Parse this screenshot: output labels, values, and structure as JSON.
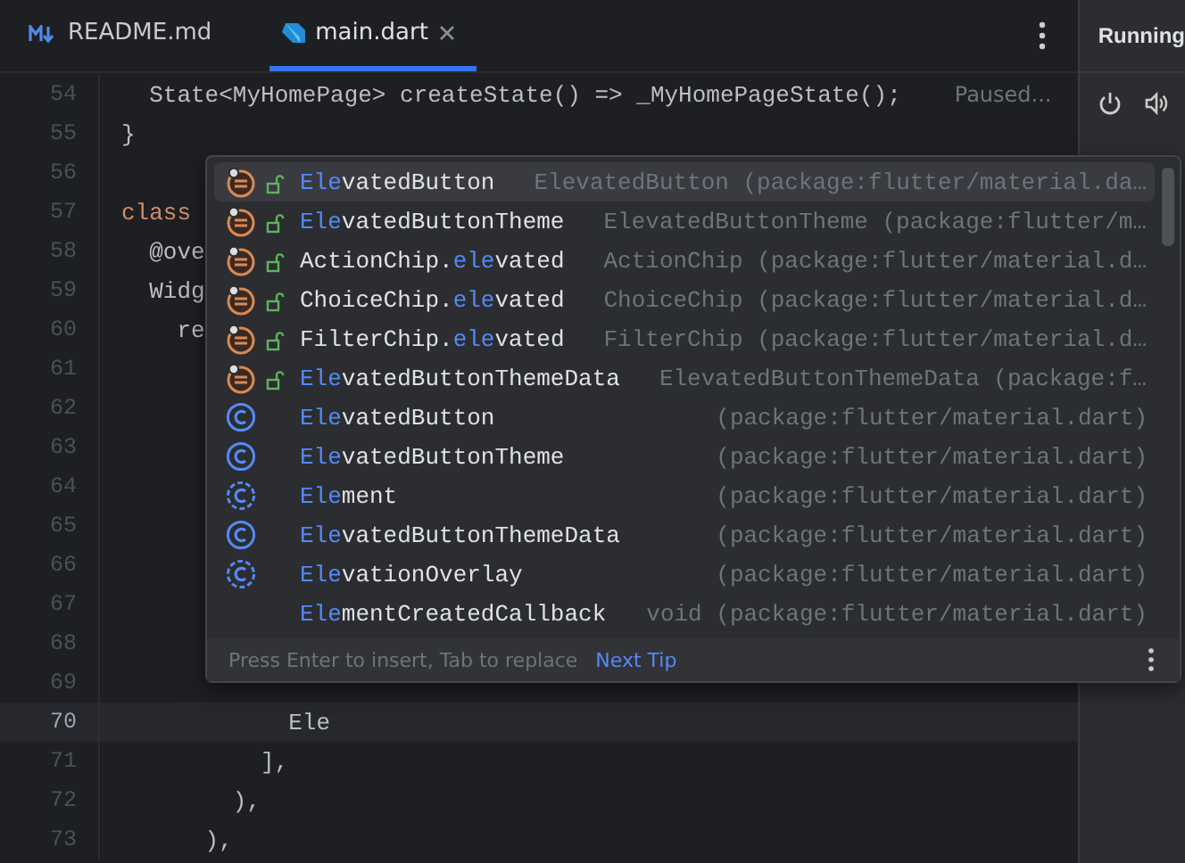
{
  "tabs": [
    {
      "label": "README.md",
      "kind": "markdown",
      "selected": false
    },
    {
      "label": "main.dart",
      "kind": "dart",
      "selected": true
    }
  ],
  "run_panel": {
    "title": "Running"
  },
  "editor": {
    "inlay_hint": "Paused...",
    "lines": [
      {
        "number": "54",
        "text": "  State<MyHomePage> createState() => _MyHomePageState();",
        "kind": "code",
        "current": false
      },
      {
        "number": "55",
        "text": "}",
        "kind": "code",
        "current": false
      },
      {
        "number": "56",
        "current": false
      },
      {
        "number": "57",
        "text": "class",
        "kind": "keyword",
        "current": false
      },
      {
        "number": "58",
        "text": "  @ove",
        "kind": "code",
        "current": false
      },
      {
        "number": "59",
        "text": "  Widg",
        "kind": "code",
        "current": false
      },
      {
        "number": "60",
        "text": "    re",
        "kind": "code",
        "current": false
      },
      {
        "number": "61",
        "current": false
      },
      {
        "number": "62",
        "current": false
      },
      {
        "number": "63",
        "current": false
      },
      {
        "number": "64",
        "current": false
      },
      {
        "number": "65",
        "current": false
      },
      {
        "number": "66",
        "current": false
      },
      {
        "number": "67",
        "current": false
      },
      {
        "number": "68",
        "current": false
      },
      {
        "number": "69",
        "current": false
      },
      {
        "number": "70",
        "text": "            Ele",
        "kind": "code",
        "current": true
      },
      {
        "number": "71",
        "text": "          ],",
        "kind": "code",
        "current": false
      },
      {
        "number": "72",
        "text": "        ),",
        "kind": "code",
        "current": false
      },
      {
        "number": "73",
        "text": "      ),",
        "kind": "code",
        "current": false
      }
    ]
  },
  "completion": {
    "items": [
      {
        "kind": "method",
        "match": "Ele",
        "after": "vatedButton",
        "type": "ElevatedButton (package:flutter/material.da…",
        "selected": true
      },
      {
        "kind": "method",
        "match": "Ele",
        "after": "vatedButtonTheme",
        "type": "ElevatedButtonTheme (package:flutter/m…",
        "selected": false
      },
      {
        "kind": "method",
        "before": "ActionChip.",
        "match": "ele",
        "after": "vated",
        "type": "ActionChip (package:flutter/material.d…",
        "selected": false
      },
      {
        "kind": "method",
        "before": "ChoiceChip.",
        "match": "ele",
        "after": "vated",
        "type": "ChoiceChip (package:flutter/material.d…",
        "selected": false
      },
      {
        "kind": "method",
        "before": "FilterChip.",
        "match": "ele",
        "after": "vated",
        "type": "FilterChip (package:flutter/material.d…",
        "selected": false
      },
      {
        "kind": "method",
        "match": "Ele",
        "after": "vatedButtonThemeData",
        "type": "ElevatedButtonThemeData (package:f…",
        "selected": false
      },
      {
        "kind": "class",
        "match": "Ele",
        "after": "vatedButton",
        "type": "(package:flutter/material.dart)",
        "selected": false
      },
      {
        "kind": "class",
        "match": "Ele",
        "after": "vatedButtonTheme",
        "type": "(package:flutter/material.dart)",
        "selected": false
      },
      {
        "kind": "abstract-class",
        "match": "Ele",
        "after": "ment",
        "type": "(package:flutter/material.dart)",
        "selected": false
      },
      {
        "kind": "class",
        "match": "Ele",
        "after": "vatedButtonThemeData",
        "type": "(package:flutter/material.dart)",
        "selected": false
      },
      {
        "kind": "abstract-class",
        "match": "Ele",
        "after": "vationOverlay",
        "type": "(package:flutter/material.dart)",
        "selected": false
      },
      {
        "kind": "typedef",
        "match": "Ele",
        "after": "mentCreatedCallback",
        "type": "void (package:flutter/material.dart)",
        "selected": false
      }
    ],
    "hint": "Press Enter to insert, Tab to replace",
    "tip_link": "Next Tip"
  }
}
